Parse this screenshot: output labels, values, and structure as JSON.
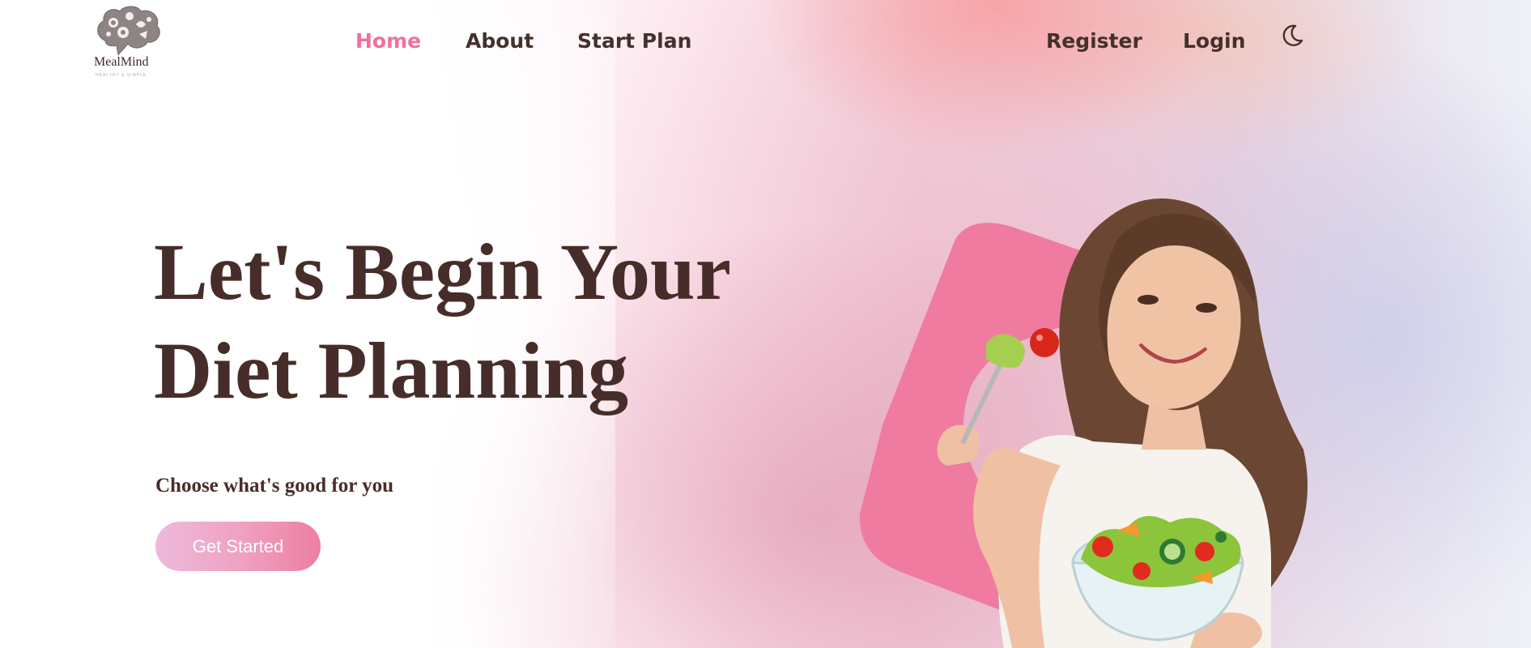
{
  "brand": {
    "name": "MealMind",
    "tagline": "HEALTHY & SIMPLE"
  },
  "nav": {
    "links": [
      {
        "label": "Home",
        "active": true
      },
      {
        "label": "About",
        "active": false
      },
      {
        "label": "Start Plan",
        "active": false
      }
    ],
    "auth": {
      "register": "Register",
      "login": "Login"
    },
    "theme_toggle_icon": "moon-icon"
  },
  "hero": {
    "title_line1": "Let's Begin Your",
    "title_line2": "Diet Planning",
    "subtitle": "Choose what's good for you",
    "cta_label": "Get Started",
    "image": "woman-eating-salad-illustration"
  },
  "colors": {
    "accent": "#f0709c",
    "text_dark": "#472d29",
    "shape_pink": "#ef7ba0",
    "button_gradient_start": "#ecbadc",
    "button_gradient_end": "#ec7fa2"
  }
}
